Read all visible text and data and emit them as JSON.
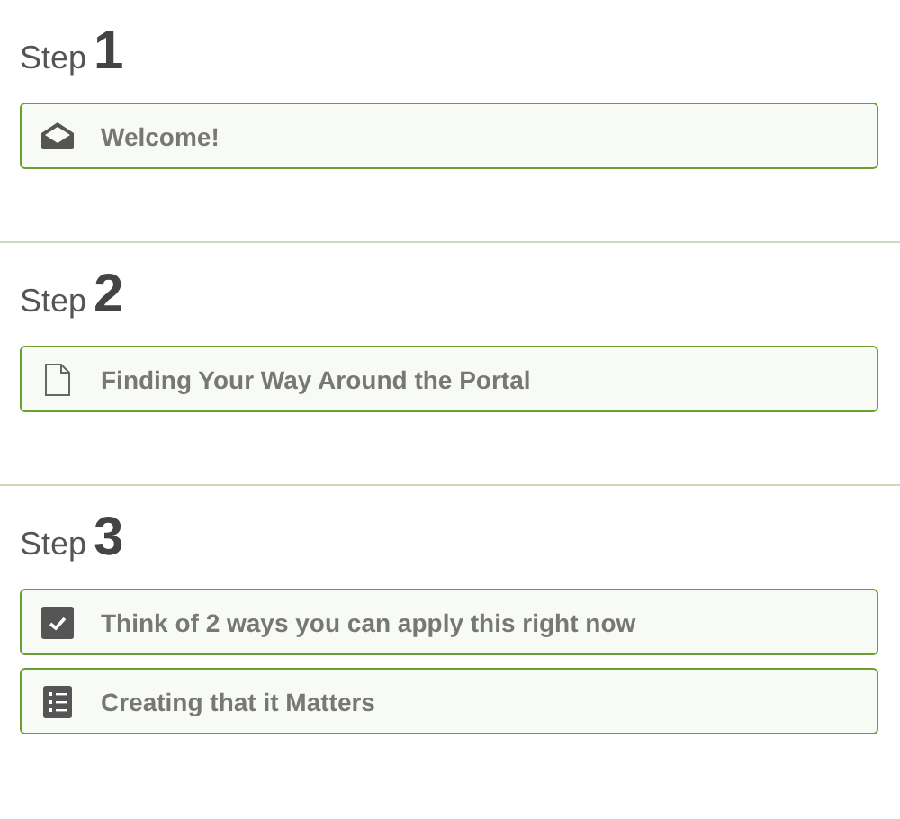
{
  "steps": [
    {
      "label": "Step",
      "number": "1",
      "items": [
        {
          "kind": "envelope",
          "title": "Welcome!"
        }
      ]
    },
    {
      "label": "Step",
      "number": "2",
      "items": [
        {
          "kind": "page",
          "title": "Finding Your Way Around the Portal"
        }
      ]
    },
    {
      "label": "Step",
      "number": "3",
      "items": [
        {
          "kind": "check",
          "title": "Think of 2 ways you can apply this right now"
        },
        {
          "kind": "list",
          "title": "Creating that it Matters"
        }
      ]
    }
  ]
}
